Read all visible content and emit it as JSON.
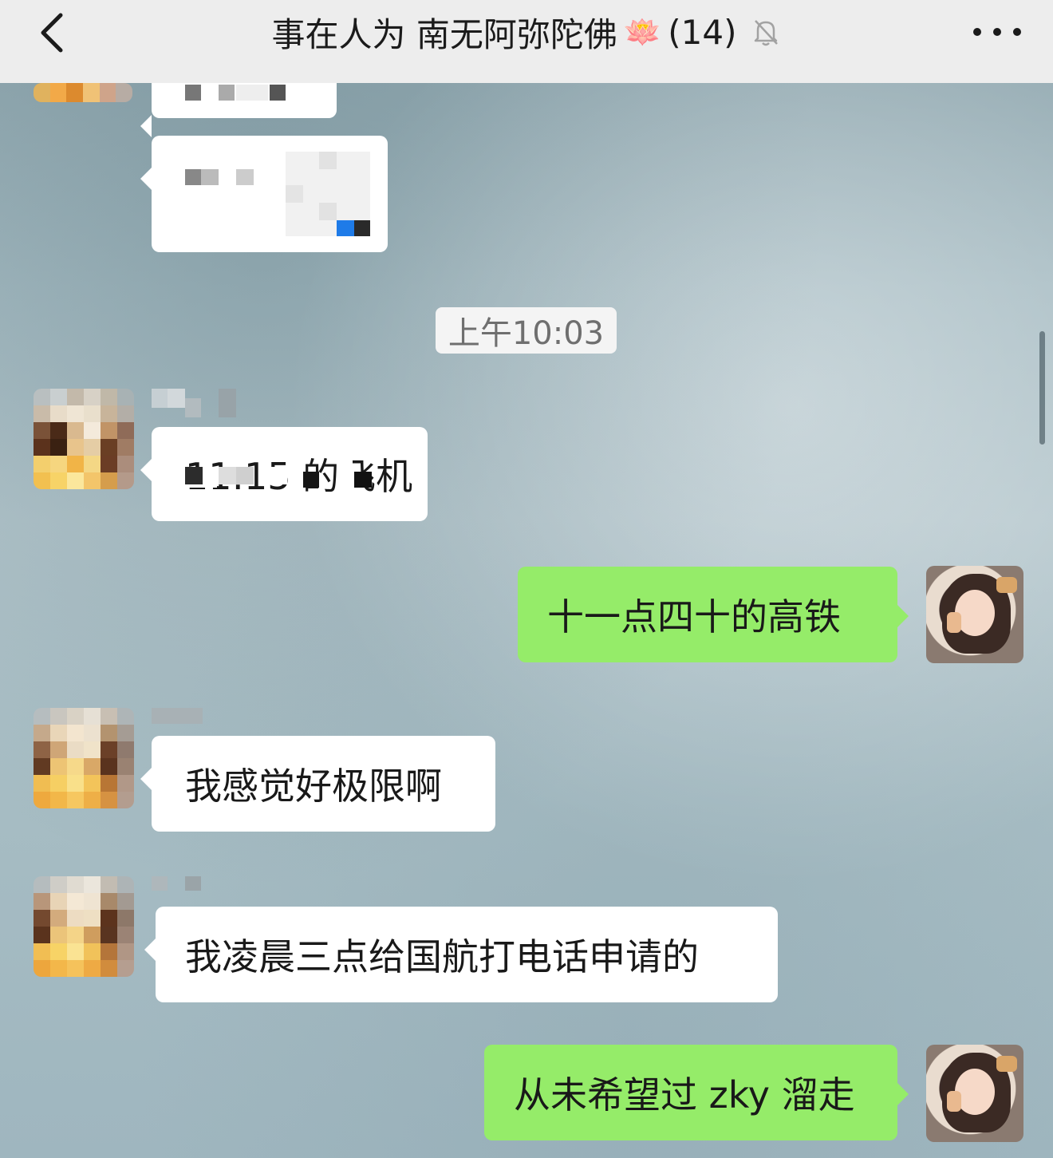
{
  "navbar": {
    "title": "事在人为 南无阿弥陀佛",
    "emoji": "🪷",
    "count": "(14)",
    "back_icon": "chevron-left-icon",
    "mute_icon": "bell-muted-icon",
    "more_icon": "more-dots-icon"
  },
  "timestamp": "上午10:03",
  "messages": [
    {
      "side": "in",
      "text": ""
    },
    {
      "side": "in",
      "text": ""
    },
    {
      "side": "in",
      "text": "11:15 的飞机"
    },
    {
      "side": "out",
      "text": "十一点四十的高铁"
    },
    {
      "side": "in",
      "text": "我感觉好极限啊"
    },
    {
      "side": "in",
      "text": "我凌晨三点给国航打电话申请的"
    },
    {
      "side": "out",
      "text": "从未希望过 zky 溜走"
    }
  ],
  "colors": {
    "navbar_bg": "#ededed",
    "bubble_in": "#ffffff",
    "bubble_out": "#95ec69",
    "timestamp_bg": "#f4f4f4"
  }
}
